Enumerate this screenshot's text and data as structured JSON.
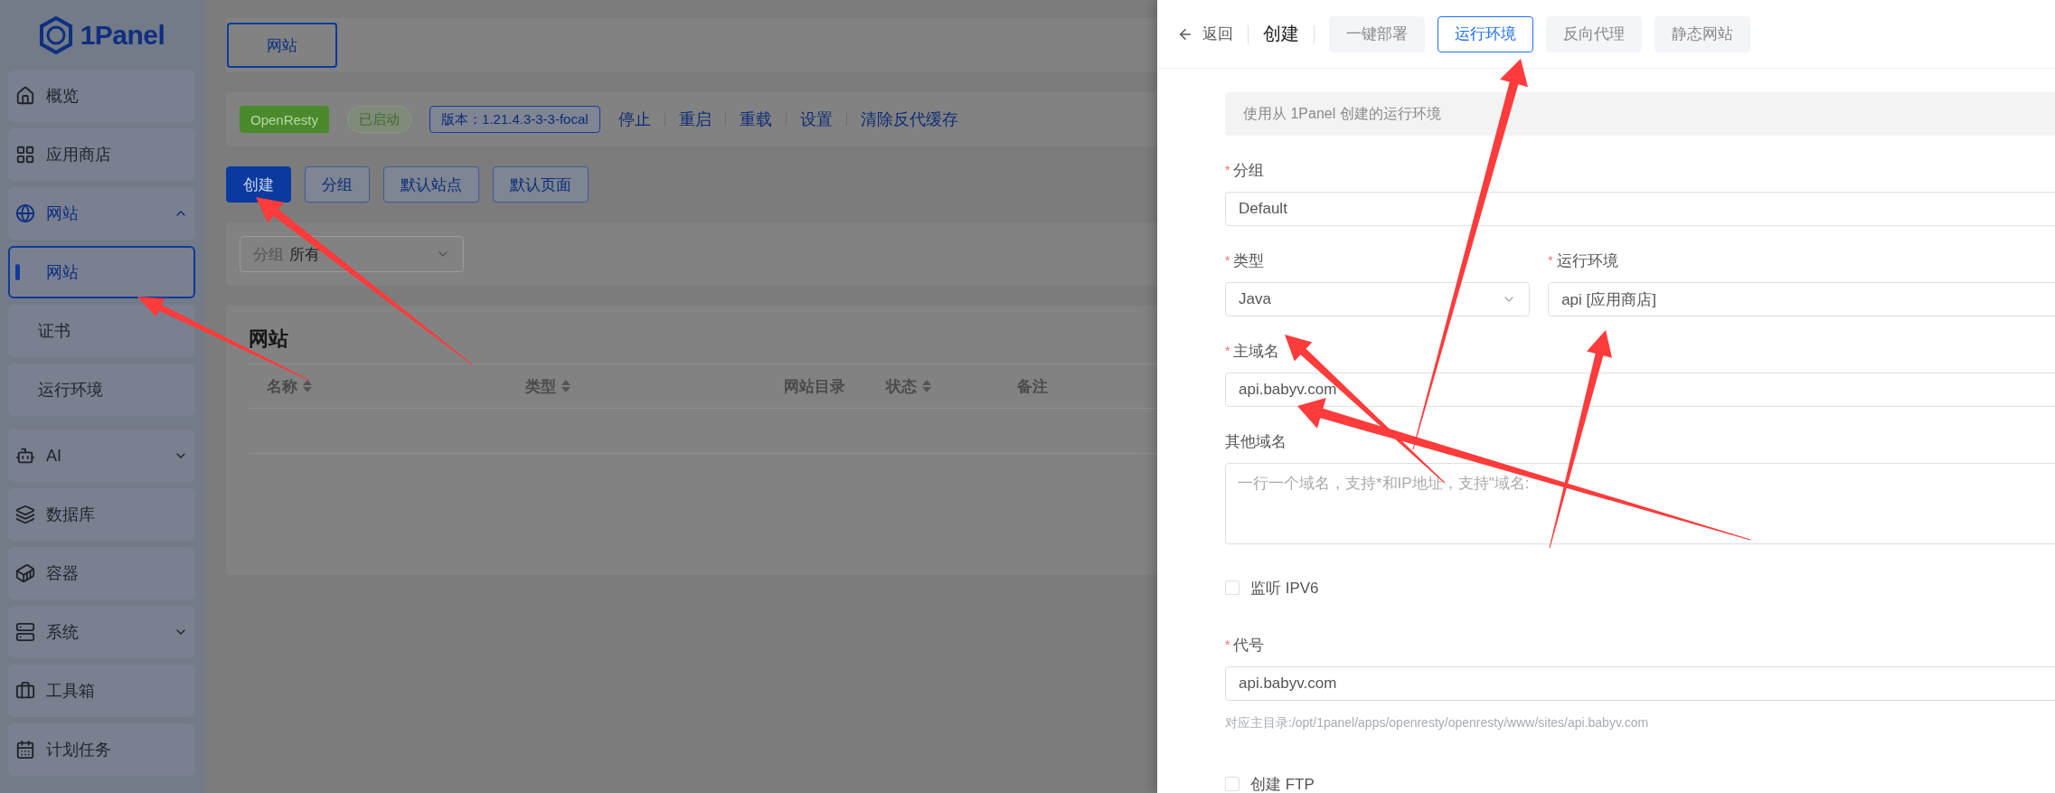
{
  "sidebar": {
    "logo": "1Panel",
    "items": [
      {
        "label": "概览",
        "kind": "link",
        "selected": false
      },
      {
        "label": "应用商店",
        "kind": "link",
        "selected": false
      },
      {
        "label": "网站",
        "kind": "group",
        "expanded": true,
        "selected": true,
        "children": [
          {
            "label": "网站",
            "selected": true
          },
          {
            "label": "证书",
            "selected": false
          },
          {
            "label": "运行环境",
            "selected": false
          }
        ]
      },
      {
        "label": "AI",
        "kind": "group",
        "expanded": false,
        "selected": false
      },
      {
        "label": "数据库",
        "kind": "link",
        "selected": false
      },
      {
        "label": "容器",
        "kind": "link",
        "selected": false
      },
      {
        "label": "系统",
        "kind": "group",
        "expanded": false,
        "selected": false
      },
      {
        "label": "工具箱",
        "kind": "link",
        "selected": false
      },
      {
        "label": "计划任务",
        "kind": "link",
        "selected": false
      }
    ]
  },
  "page_tabs": [
    {
      "label": "网站",
      "selected": true
    }
  ],
  "server_bar": {
    "app": "OpenResty",
    "status": "已启动",
    "version": "版本：1.21.4.3-3-3-focal",
    "actions": [
      "停止",
      "重启",
      "重载",
      "设置",
      "清除反代缓存"
    ]
  },
  "toolbar": [
    {
      "label": "创建",
      "kind": "primary"
    },
    {
      "label": "分组",
      "kind": "plain"
    },
    {
      "label": "默认站点",
      "kind": "plain"
    },
    {
      "label": "默认页面",
      "kind": "plain"
    }
  ],
  "filter": {
    "label": "分组",
    "value": "所有"
  },
  "table": {
    "title": "网站",
    "columns": [
      {
        "label": "名称",
        "sortable": true
      },
      {
        "label": "类型",
        "sortable": true
      },
      {
        "label": "网站目录",
        "sortable": false
      },
      {
        "label": "状态",
        "sortable": true
      },
      {
        "label": "备注",
        "sortable": false
      }
    ]
  },
  "drawer": {
    "back": "返回",
    "title": "创建",
    "tabs": [
      {
        "label": "一键部署",
        "selected": false
      },
      {
        "label": "运行环境",
        "selected": true
      },
      {
        "label": "反向代理",
        "selected": false
      },
      {
        "label": "静态网站",
        "selected": false
      }
    ],
    "notice": "使用从 1Panel 创建的运行环境",
    "fields": [
      {
        "kind": "input",
        "label": "分组",
        "required_mark": "*",
        "value": "Default"
      },
      {
        "kind": "pair",
        "items": [
          {
            "kind": "select",
            "label": "类型",
            "required_mark": "*",
            "value": "Java"
          },
          {
            "kind": "input",
            "label": "运行环境",
            "required_mark": "*",
            "value": "api [应用商店]"
          }
        ]
      },
      {
        "kind": "input",
        "label": "主域名",
        "required_mark": "*",
        "value": "api.babyv.com"
      },
      {
        "kind": "textarea",
        "label": "其他域名",
        "placeholder": "一行一个域名，支持*和IP地址，支持\"域名:"
      },
      {
        "kind": "checkbox",
        "label": "监听 IPV6",
        "checked": false
      },
      {
        "kind": "input",
        "label": "代号",
        "required_mark": "*",
        "value": "api.babyv.com",
        "hint": "对应主目录:/opt/1panel/apps/openresty/openresty/www/sites/api.babyv.com"
      },
      {
        "kind": "checkbox",
        "label": "创建 FTP",
        "checked": false
      }
    ]
  }
}
